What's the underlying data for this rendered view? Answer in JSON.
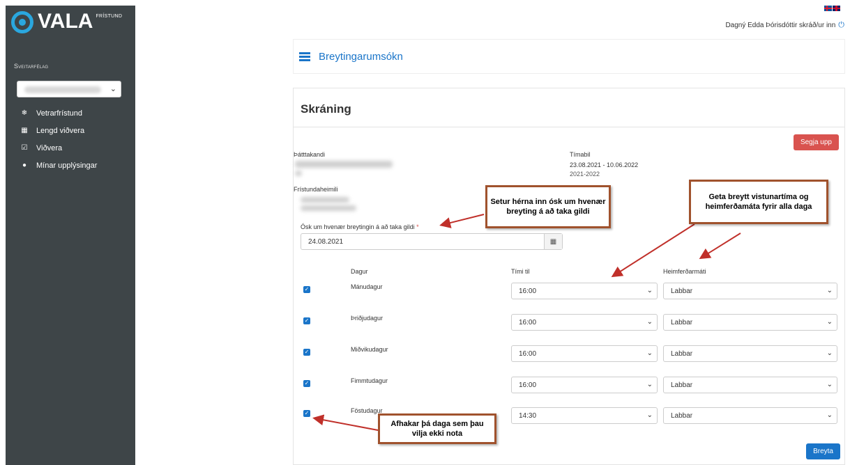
{
  "brand": {
    "name": "VALA",
    "sub": "FRÍSTUND"
  },
  "sidebar": {
    "municipality_label": "Sveitarfélag",
    "items": [
      {
        "label": "Vetrarfrístund",
        "icon": "snowflake-icon"
      },
      {
        "label": "Lengd viðvera",
        "icon": "calendar-icon"
      },
      {
        "label": "Viðvera",
        "icon": "calendar-check-icon"
      },
      {
        "label": "Mínar upplýsingar",
        "icon": "user-icon"
      }
    ]
  },
  "header": {
    "user_text": "Dagný Edda Þórisdóttir skráð/ur inn"
  },
  "titlebar": {
    "title": "Breytingarumsókn"
  },
  "form": {
    "title": "Skráning",
    "cancel_label": "Segja upp",
    "participant_label": "Þátttakandi",
    "period_label": "Tímabil",
    "period_value": "23.08.2021 - 10.06.2022",
    "period_year": "2021-2022",
    "home_label": "Frístundaheimili",
    "date_label": "Ósk um hvenær breytingin á að taka gildi",
    "date_value": "24.08.2021",
    "col_day": "Dagur",
    "col_time": "Tími til",
    "col_transport": "Heimferðarmáti",
    "rows": [
      {
        "day": "Mánudagur",
        "time": "16:00",
        "transport": "Labbar"
      },
      {
        "day": "Þriðjudagur",
        "time": "16:00",
        "transport": "Labbar"
      },
      {
        "day": "Miðvikudagur",
        "time": "16:00",
        "transport": "Labbar"
      },
      {
        "day": "Fimmtudagur",
        "time": "16:00",
        "transport": "Labbar"
      },
      {
        "day": "Föstudagur",
        "time": "14:30",
        "transport": "Labbar"
      }
    ],
    "submit_label": "Breyta"
  },
  "annotations": {
    "date_note": "Setur hérna inn ósk um hvenær breyting á að taka gildi",
    "all_days_note": "Geta breytt vistunartíma og heimferðamáta fyrir alla daga",
    "uncheck_note": "Afhakar þá daga sem þau vilja ekki nota"
  },
  "colors": {
    "accent": "#1a75c9",
    "danger": "#d9534f",
    "sidebar": "#3e4548",
    "annotation_border": "#a0522d"
  }
}
